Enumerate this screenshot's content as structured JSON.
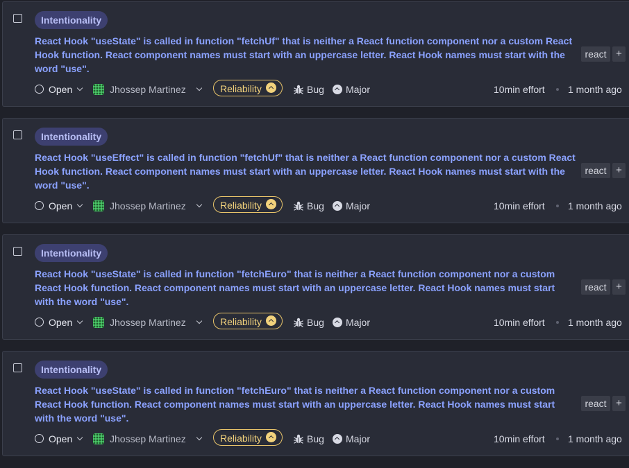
{
  "issues": [
    {
      "tag": "Intentionality",
      "message": "React Hook \"useState\" is called in function \"fetchUf\" that is neither a React function component nor a custom React Hook function. React component names must start with an uppercase letter. React Hook names must start with the word \"use\".",
      "tag_chip": "react",
      "add_tag": "+",
      "status": "Open",
      "assignee": "Jhossep Martinez",
      "quality": "Reliability",
      "type": "Bug",
      "severity": "Major",
      "effort": "10min effort",
      "age": "1 month ago"
    },
    {
      "tag": "Intentionality",
      "message": "React Hook \"useEffect\" is called in function \"fetchUf\" that is neither a React function component nor a custom React Hook function. React component names must start with an uppercase letter. React Hook names must start with the word \"use\".",
      "tag_chip": "react",
      "add_tag": "+",
      "status": "Open",
      "assignee": "Jhossep Martinez",
      "quality": "Reliability",
      "type": "Bug",
      "severity": "Major",
      "effort": "10min effort",
      "age": "1 month ago"
    },
    {
      "tag": "Intentionality",
      "message": "React Hook \"useState\" is called in function \"fetchEuro\" that is neither a React function component nor a custom React Hook function. React component names must start with an uppercase letter. React Hook names must start with the word \"use\".",
      "tag_chip": "react",
      "add_tag": "+",
      "status": "Open",
      "assignee": "Jhossep Martinez",
      "quality": "Reliability",
      "type": "Bug",
      "severity": "Major",
      "effort": "10min effort",
      "age": "1 month ago"
    },
    {
      "tag": "Intentionality",
      "message": "React Hook \"useState\" is called in function \"fetchEuro\" that is neither a React function component nor a custom React Hook function. React component names must start with an uppercase letter. React Hook names must start with the word \"use\".",
      "tag_chip": "react",
      "add_tag": "+",
      "status": "Open",
      "assignee": "Jhossep Martinez",
      "quality": "Reliability",
      "type": "Bug",
      "severity": "Major",
      "effort": "10min effort",
      "age": "1 month ago"
    }
  ],
  "colors": {
    "message": "#8ba2ff",
    "reliability": "#f2d27c",
    "intentionality_bg": "#3d4070",
    "card_bg": "#292c37"
  },
  "icons": {
    "status": "circle-icon",
    "type": "bug-icon",
    "severity": "major-severity-icon",
    "quality_severity": "chevron-up-circle-icon"
  }
}
